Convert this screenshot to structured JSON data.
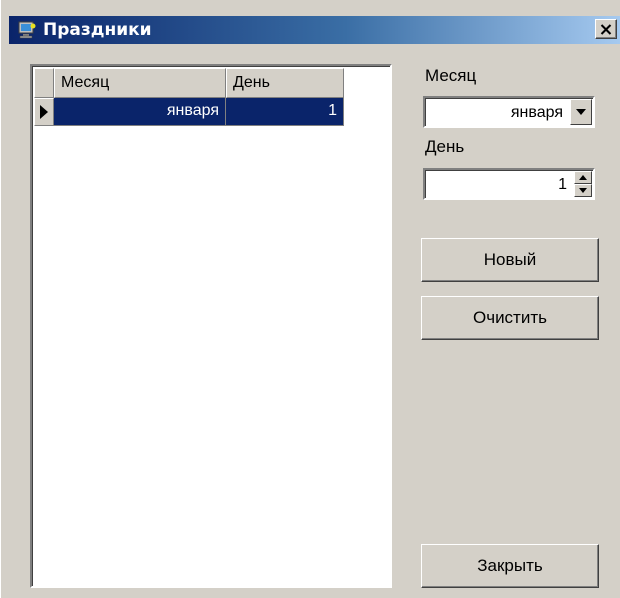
{
  "window": {
    "title": "Праздники",
    "icon": "app-computer-icon",
    "close_icon": "close-icon",
    "close_glyph": "✕"
  },
  "grid": {
    "columns": [
      "Месяц",
      "День"
    ],
    "rows": [
      {
        "month": "января",
        "day": "1",
        "selected": true
      }
    ],
    "selection_color": "#0a246a"
  },
  "panel": {
    "month_label": "Месяц",
    "month_value": "января",
    "day_label": "День",
    "day_value": "1",
    "new_button": "Новый",
    "clear_button": "Очистить",
    "close_button": "Закрыть"
  },
  "colors": {
    "title_start": "#0a246a",
    "title_end": "#a6caf0",
    "face": "#d4d0c8"
  }
}
